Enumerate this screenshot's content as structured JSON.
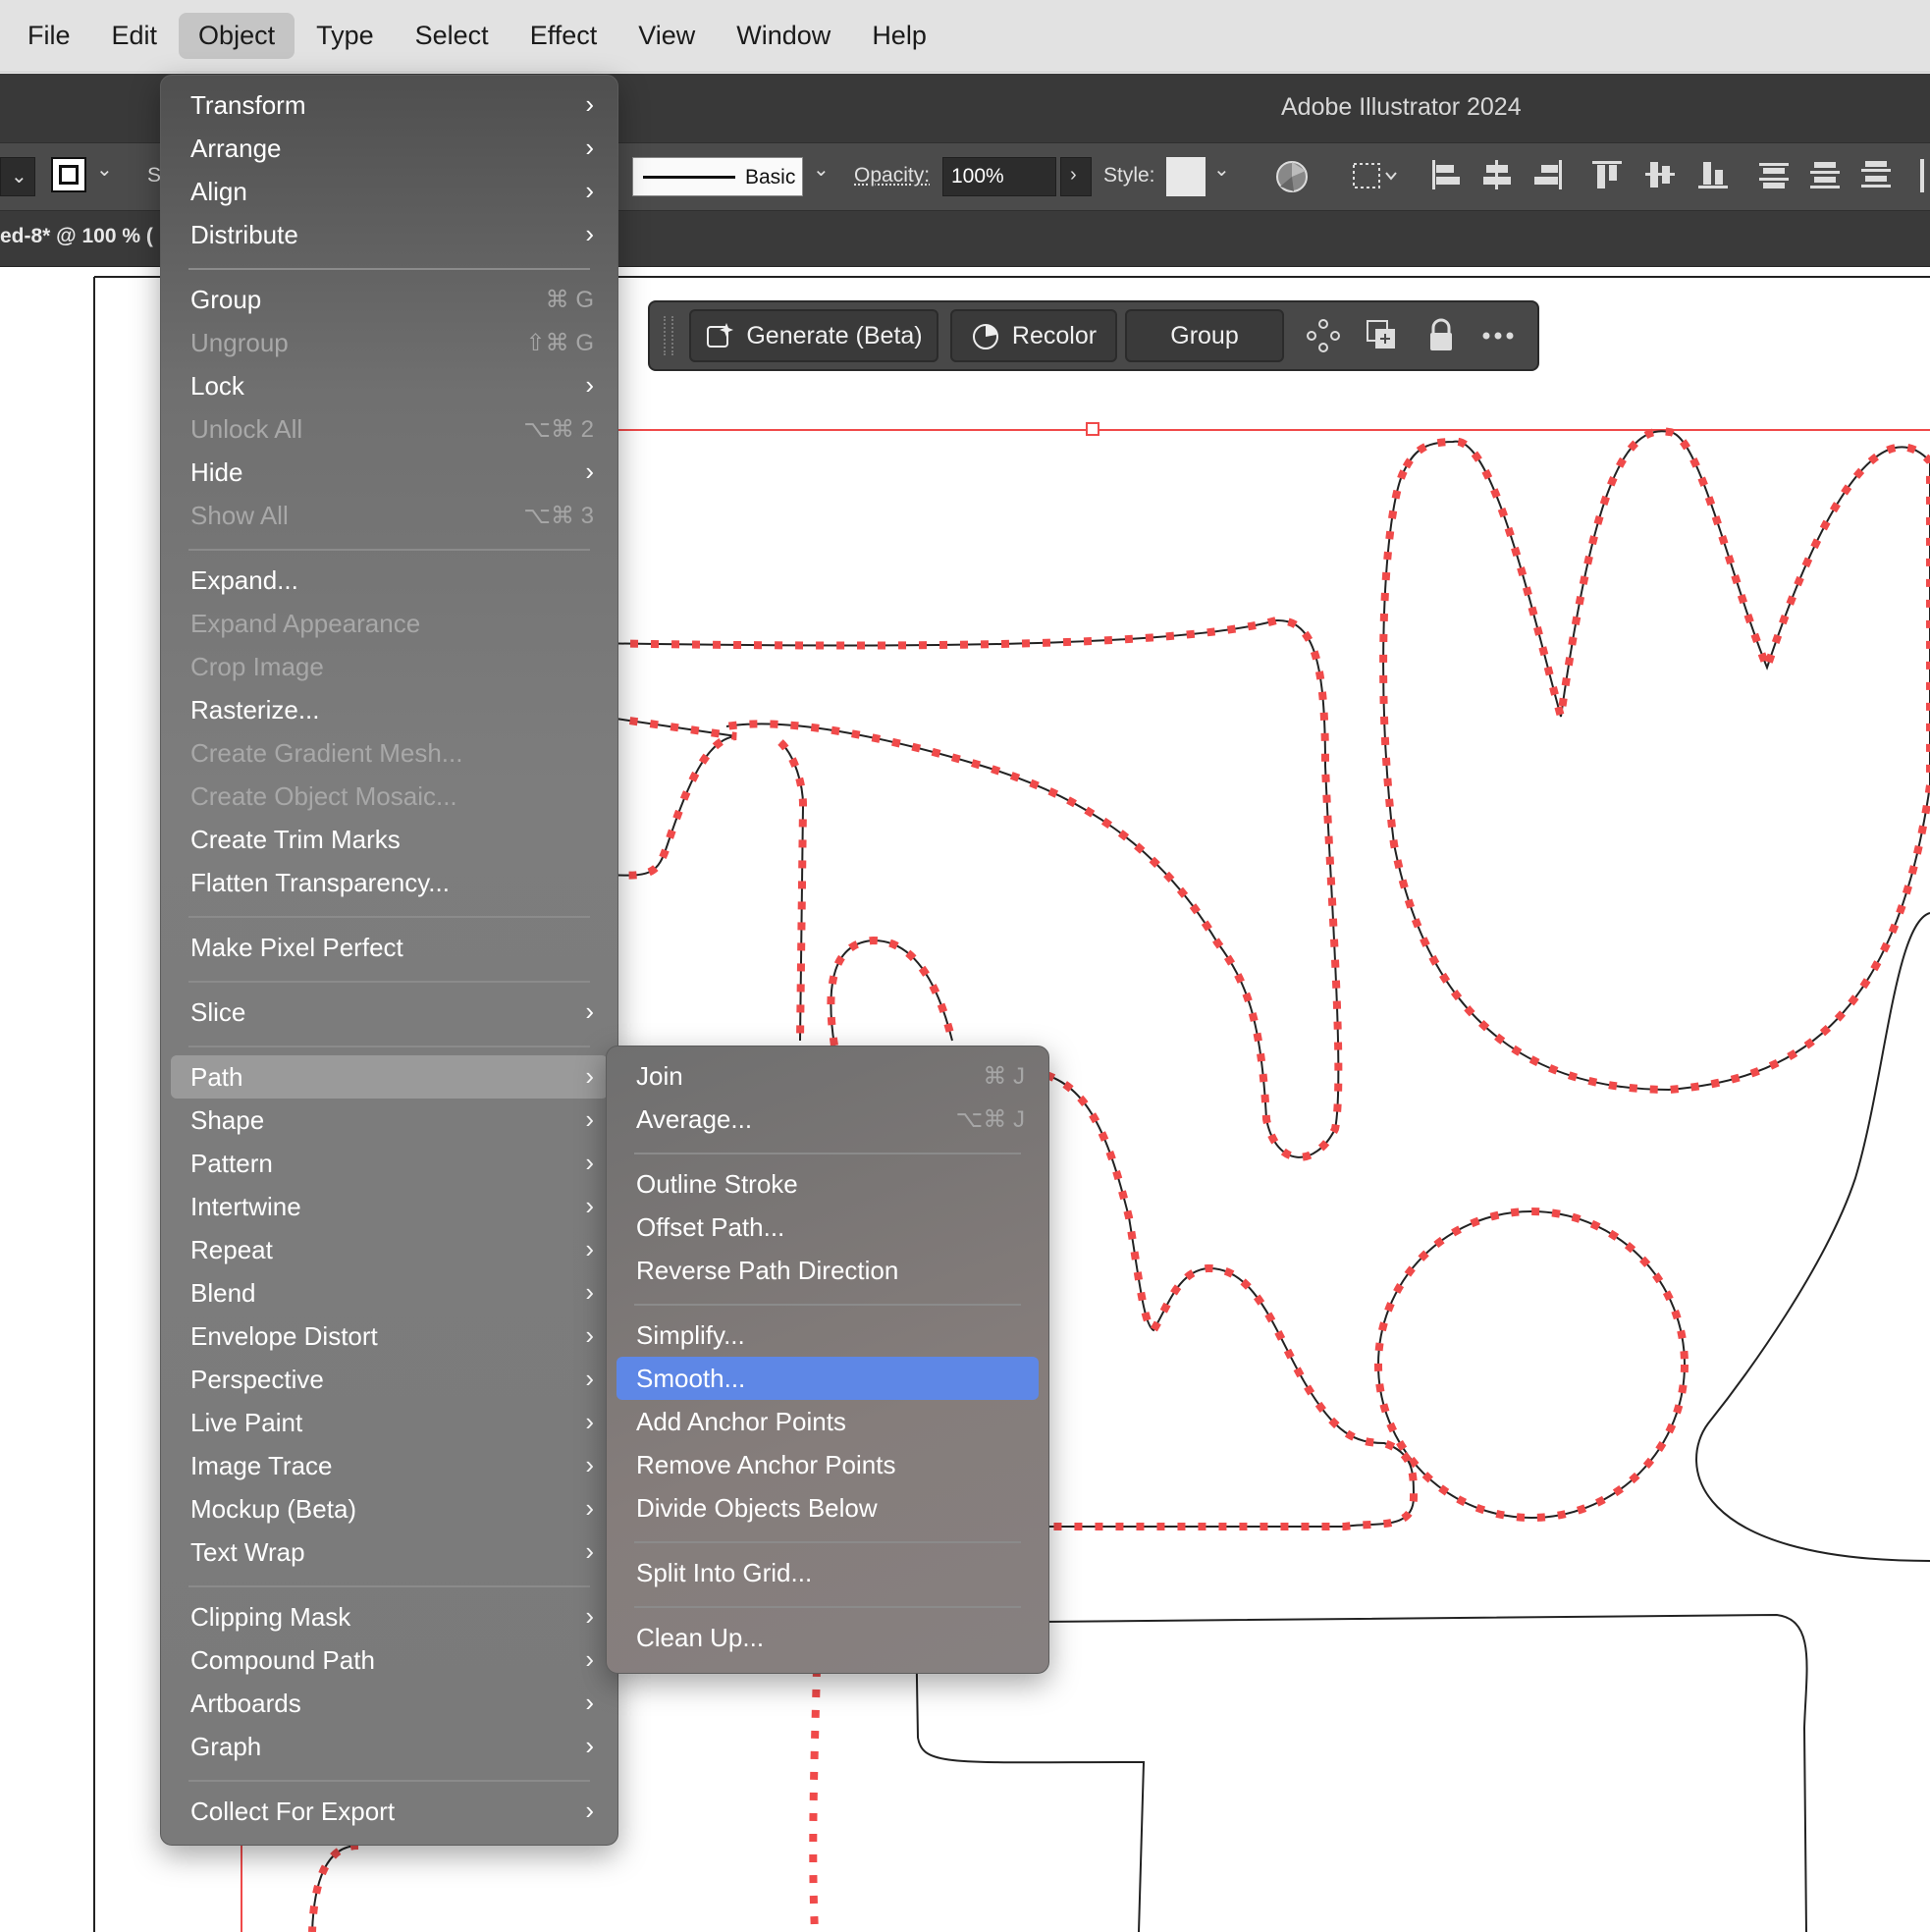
{
  "menubar": {
    "items": [
      "File",
      "Edit",
      "Object",
      "Type",
      "Select",
      "Effect",
      "View",
      "Window",
      "Help"
    ],
    "active": "Object"
  },
  "app": {
    "title": "Adobe Illustrator 2024"
  },
  "controlbar": {
    "stroke_profile": "Basic",
    "opacity_label": "Opacity:",
    "opacity_value": "100%",
    "style_label": "Style:",
    "cut_label": "S"
  },
  "document": {
    "tab_label": "ed-8* @ 100 % ("
  },
  "taskbar": {
    "generate_label": "Generate (Beta)",
    "recolor_label": "Recolor",
    "group_label": "Group"
  },
  "object_menu": {
    "items": [
      {
        "label": "Transform",
        "submenu": true
      },
      {
        "label": "Arrange",
        "submenu": true
      },
      {
        "label": "Align",
        "submenu": true
      },
      {
        "label": "Distribute",
        "submenu": true
      },
      {
        "label": "Group",
        "shortcut": "⌘ G"
      },
      {
        "label": "Ungroup",
        "shortcut": "⇧⌘ G",
        "disabled": true
      },
      {
        "label": "Lock",
        "submenu": true
      },
      {
        "label": "Unlock All",
        "shortcut": "⌥⌘ 2",
        "disabled": true
      },
      {
        "label": "Hide",
        "submenu": true
      },
      {
        "label": "Show All",
        "shortcut": "⌥⌘ 3",
        "disabled": true
      },
      {
        "label": "Expand..."
      },
      {
        "label": "Expand Appearance",
        "disabled": true
      },
      {
        "label": "Crop Image",
        "disabled": true
      },
      {
        "label": "Rasterize..."
      },
      {
        "label": "Create Gradient Mesh...",
        "disabled": true
      },
      {
        "label": "Create Object Mosaic...",
        "disabled": true
      },
      {
        "label": "Create Trim Marks"
      },
      {
        "label": "Flatten Transparency..."
      },
      {
        "label": "Make Pixel Perfect"
      },
      {
        "label": "Slice",
        "submenu": true
      },
      {
        "label": "Path",
        "submenu": true,
        "highlighted": true
      },
      {
        "label": "Shape",
        "submenu": true
      },
      {
        "label": "Pattern",
        "submenu": true
      },
      {
        "label": "Intertwine",
        "submenu": true
      },
      {
        "label": "Repeat",
        "submenu": true
      },
      {
        "label": "Blend",
        "submenu": true
      },
      {
        "label": "Envelope Distort",
        "submenu": true
      },
      {
        "label": "Perspective",
        "submenu": true
      },
      {
        "label": "Live Paint",
        "submenu": true
      },
      {
        "label": "Image Trace",
        "submenu": true
      },
      {
        "label": "Mockup (Beta)",
        "submenu": true
      },
      {
        "label": "Text Wrap",
        "submenu": true
      },
      {
        "label": "Clipping Mask",
        "submenu": true
      },
      {
        "label": "Compound Path",
        "submenu": true
      },
      {
        "label": "Artboards",
        "submenu": true
      },
      {
        "label": "Graph",
        "submenu": true
      },
      {
        "label": "Collect For Export",
        "submenu": true
      }
    ]
  },
  "path_submenu": {
    "items": [
      {
        "label": "Join",
        "shortcut": "⌘ J"
      },
      {
        "label": "Average...",
        "shortcut": "⌥⌘ J"
      },
      {
        "label": "Outline Stroke"
      },
      {
        "label": "Offset Path..."
      },
      {
        "label": "Reverse Path Direction"
      },
      {
        "label": "Simplify..."
      },
      {
        "label": "Smooth...",
        "selected": true
      },
      {
        "label": "Add Anchor Points"
      },
      {
        "label": "Remove Anchor Points"
      },
      {
        "label": "Divide Objects Below"
      },
      {
        "label": "Split Into Grid..."
      },
      {
        "label": "Clean Up..."
      }
    ]
  },
  "colors": {
    "selection": "#f04a4a",
    "menu_highlight": "#5e87e6",
    "control_bar": "#4b4b4b"
  }
}
